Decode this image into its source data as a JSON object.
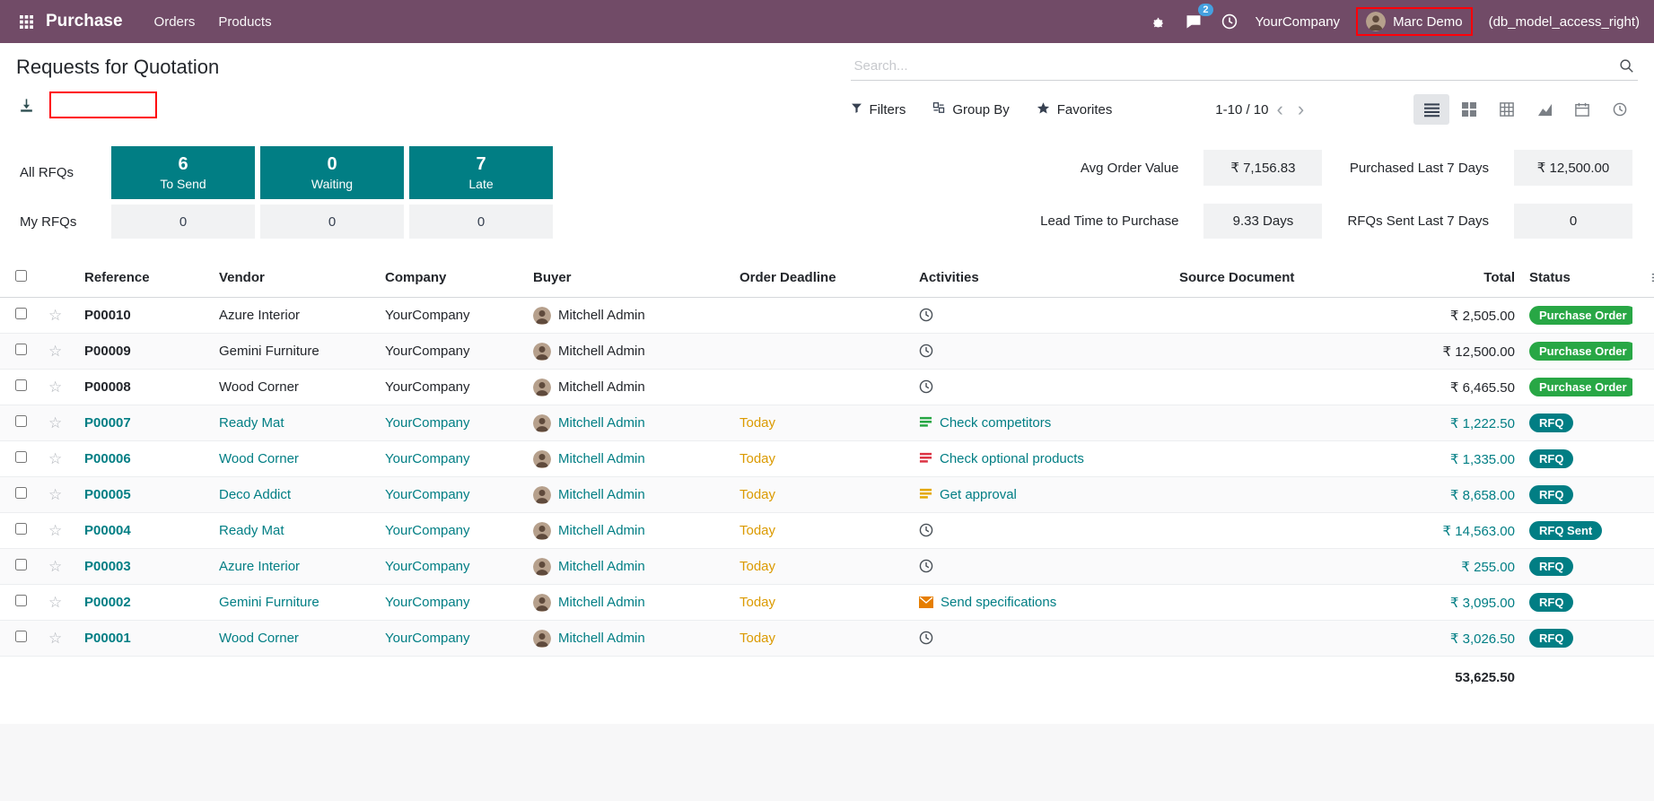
{
  "colors": {
    "navbar": "#714B67",
    "accent": "#017E84",
    "success": "#28a745",
    "warning": "#db9a00",
    "annotation": "#ff0008"
  },
  "navbar": {
    "app": "Purchase",
    "menus": [
      "Orders",
      "Products"
    ],
    "messages_count": "2",
    "company": "YourCompany",
    "user": "Marc Demo",
    "note": "(db_model_access_right)"
  },
  "control_panel": {
    "title": "Requests for Quotation",
    "search_placeholder": "Search...",
    "filters_label": "Filters",
    "group_by_label": "Group By",
    "favorites_label": "Favorites",
    "pager": "1-10 / 10"
  },
  "dashboard": {
    "row_labels": [
      "All RFQs",
      "My RFQs"
    ],
    "kpis": [
      {
        "value": "6",
        "label": "To Send"
      },
      {
        "value": "0",
        "label": "Waiting"
      },
      {
        "value": "7",
        "label": "Late"
      }
    ],
    "my_values": [
      "0",
      "0",
      "0"
    ],
    "stats": [
      {
        "label": "Avg Order Value",
        "value": "₹ 7,156.83"
      },
      {
        "label": "Purchased Last 7 Days",
        "value": "₹ 12,500.00"
      },
      {
        "label": "Lead Time to Purchase",
        "value": "9.33 Days"
      },
      {
        "label": "RFQs Sent Last 7 Days",
        "value": "0"
      }
    ]
  },
  "table": {
    "headers": {
      "reference": "Reference",
      "vendor": "Vendor",
      "company": "Company",
      "buyer": "Buyer",
      "deadline": "Order Deadline",
      "activities": "Activities",
      "source": "Source Document",
      "total": "Total",
      "status": "Status"
    },
    "rows": [
      {
        "reference": "P00010",
        "vendor": "Azure Interior",
        "company": "YourCompany",
        "buyer": "Mitchell Admin",
        "deadline": "",
        "activity": {
          "type": "clock",
          "color": "#495057",
          "label": ""
        },
        "source": "",
        "total": "₹ 2,505.00",
        "status": "Purchase Order",
        "status_type": "success",
        "open": false
      },
      {
        "reference": "P00009",
        "vendor": "Gemini Furniture",
        "company": "YourCompany",
        "buyer": "Mitchell Admin",
        "deadline": "",
        "activity": {
          "type": "clock",
          "color": "#495057",
          "label": ""
        },
        "source": "",
        "total": "₹ 12,500.00",
        "status": "Purchase Order",
        "status_type": "success",
        "open": false
      },
      {
        "reference": "P00008",
        "vendor": "Wood Corner",
        "company": "YourCompany",
        "buyer": "Mitchell Admin",
        "deadline": "",
        "activity": {
          "type": "clock",
          "color": "#495057",
          "label": ""
        },
        "source": "",
        "total": "₹ 6,465.50",
        "status": "Purchase Order",
        "status_type": "success",
        "open": false
      },
      {
        "reference": "P00007",
        "vendor": "Ready Mat",
        "company": "YourCompany",
        "buyer": "Mitchell Admin",
        "deadline": "Today",
        "activity": {
          "type": "list",
          "color": "#28a745",
          "label": "Check competitors"
        },
        "source": "",
        "total": "₹ 1,222.50",
        "status": "RFQ",
        "status_type": "info",
        "open": true
      },
      {
        "reference": "P00006",
        "vendor": "Wood Corner",
        "company": "YourCompany",
        "buyer": "Mitchell Admin",
        "deadline": "Today",
        "activity": {
          "type": "list",
          "color": "#dc3545",
          "label": "Check optional products"
        },
        "source": "",
        "total": "₹ 1,335.00",
        "status": "RFQ",
        "status_type": "info",
        "open": true
      },
      {
        "reference": "P00005",
        "vendor": "Deco Addict",
        "company": "YourCompany",
        "buyer": "Mitchell Admin",
        "deadline": "Today",
        "activity": {
          "type": "list",
          "color": "#e4a900",
          "label": "Get approval"
        },
        "source": "",
        "total": "₹ 8,658.00",
        "status": "RFQ",
        "status_type": "info",
        "open": true
      },
      {
        "reference": "P00004",
        "vendor": "Ready Mat",
        "company": "YourCompany",
        "buyer": "Mitchell Admin",
        "deadline": "Today",
        "activity": {
          "type": "clock",
          "color": "#495057",
          "label": ""
        },
        "source": "",
        "total": "₹ 14,563.00",
        "status": "RFQ Sent",
        "status_type": "info",
        "open": true
      },
      {
        "reference": "P00003",
        "vendor": "Azure Interior",
        "company": "YourCompany",
        "buyer": "Mitchell Admin",
        "deadline": "Today",
        "activity": {
          "type": "clock",
          "color": "#495057",
          "label": ""
        },
        "source": "",
        "total": "₹ 255.00",
        "status": "RFQ",
        "status_type": "info",
        "open": true
      },
      {
        "reference": "P00002",
        "vendor": "Gemini Furniture",
        "company": "YourCompany",
        "buyer": "Mitchell Admin",
        "deadline": "Today",
        "activity": {
          "type": "envelope",
          "color": "#e67e00",
          "label": "Send specifications"
        },
        "source": "",
        "total": "₹ 3,095.00",
        "status": "RFQ",
        "status_type": "info",
        "open": true
      },
      {
        "reference": "P00001",
        "vendor": "Wood Corner",
        "company": "YourCompany",
        "buyer": "Mitchell Admin",
        "deadline": "Today",
        "activity": {
          "type": "clock",
          "color": "#495057",
          "label": ""
        },
        "source": "",
        "total": "₹ 3,026.50",
        "status": "RFQ",
        "status_type": "info",
        "open": true
      }
    ],
    "footer_total": "53,625.50"
  }
}
